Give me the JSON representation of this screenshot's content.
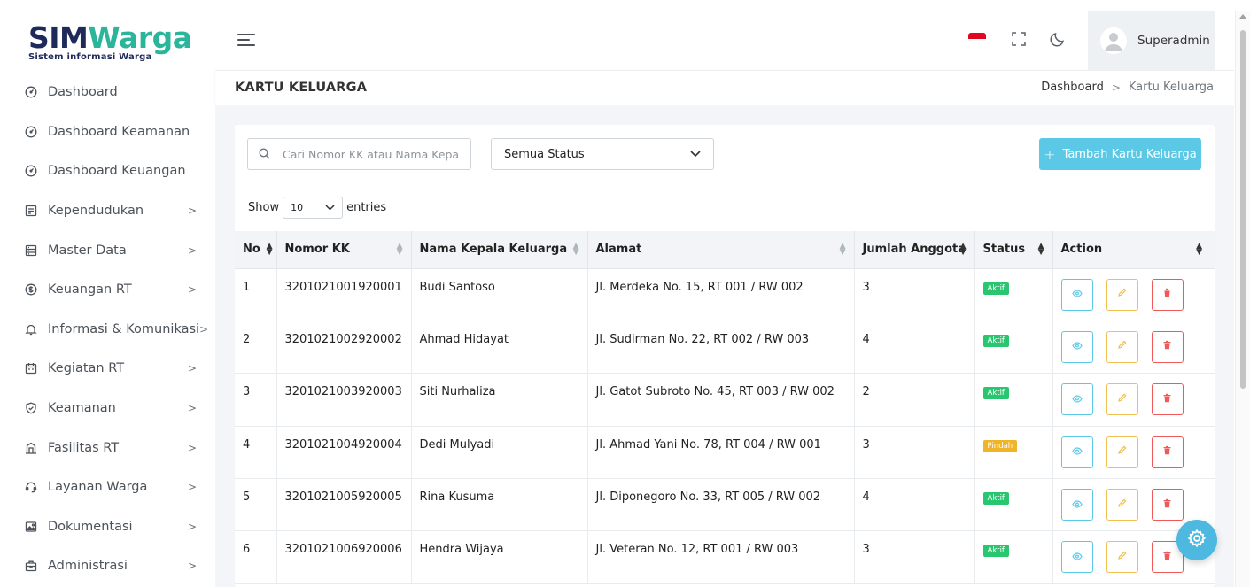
{
  "app": {
    "logo_sim": "SIM",
    "logo_warga": "Warga",
    "logo_sub": "Sistem informasi Warga"
  },
  "sidebar": {
    "items": [
      {
        "label": "Dashboard",
        "icon": "gauge-icon",
        "has_submenu": false
      },
      {
        "label": "Dashboard Keamanan",
        "icon": "gauge-icon",
        "has_submenu": false
      },
      {
        "label": "Dashboard Keuangan",
        "icon": "gauge-icon",
        "has_submenu": false
      },
      {
        "label": "Kependudukan",
        "icon": "id-card-icon",
        "has_submenu": true
      },
      {
        "label": "Master Data",
        "icon": "database-icon",
        "has_submenu": true
      },
      {
        "label": "Keuangan RT",
        "icon": "dollar-circle-icon",
        "has_submenu": true
      },
      {
        "label": "Informasi & Komunikasi",
        "icon": "bell-icon",
        "has_submenu": true
      },
      {
        "label": "Kegiatan RT",
        "icon": "calendar-icon",
        "has_submenu": true
      },
      {
        "label": "Keamanan",
        "icon": "shield-icon",
        "has_submenu": true
      },
      {
        "label": "Fasilitas RT",
        "icon": "building-icon",
        "has_submenu": true
      },
      {
        "label": "Layanan Warga",
        "icon": "support-icon",
        "has_submenu": true
      },
      {
        "label": "Dokumentasi",
        "icon": "image-icon",
        "has_submenu": true
      },
      {
        "label": "Administrasi",
        "icon": "briefcase-icon",
        "has_submenu": true
      }
    ],
    "chevron": ">"
  },
  "header": {
    "user_name": "Superadmin"
  },
  "titlebar": {
    "title": "KARTU KELUARGA",
    "breadcrumb_home": "Dashboard",
    "breadcrumb_sep": ">",
    "breadcrumb_current": "Kartu Keluarga"
  },
  "toolbar": {
    "search_placeholder": "Cari Nomor KK atau Nama Kepala Keluarga",
    "status_filter": "Semua Status",
    "add_label": "Tambah Kartu Keluarga",
    "add_plus": "+"
  },
  "length": {
    "show": "Show",
    "value": "10",
    "entries": "entries"
  },
  "table": {
    "headers": [
      "No",
      "Nomor KK",
      "Nama Kepala Keluarga",
      "Alamat",
      "Jumlah Anggota",
      "Status",
      "Action"
    ],
    "rows": [
      {
        "no": "1",
        "kk": "3201021001920001",
        "nama": "Budi Santoso",
        "alamat": "Jl. Merdeka No. 15, RT 001 / RW 002",
        "jumlah": "3",
        "status": "Aktif",
        "status_color": "#28c76f"
      },
      {
        "no": "2",
        "kk": "3201021002920002",
        "nama": "Ahmad Hidayat",
        "alamat": "Jl. Sudirman No. 22, RT 002 / RW 003",
        "jumlah": "4",
        "status": "Aktif",
        "status_color": "#28c76f"
      },
      {
        "no": "3",
        "kk": "3201021003920003",
        "nama": "Siti Nurhaliza",
        "alamat": "Jl. Gatot Subroto No. 45, RT 003 / RW 002",
        "jumlah": "2",
        "status": "Aktif",
        "status_color": "#28c76f"
      },
      {
        "no": "4",
        "kk": "3201021004920004",
        "nama": "Dedi Mulyadi",
        "alamat": "Jl. Ahmad Yani No. 78, RT 004 / RW 001",
        "jumlah": "3",
        "status": "Pindah",
        "status_color": "#f0b429"
      },
      {
        "no": "5",
        "kk": "3201021005920005",
        "nama": "Rina Kusuma",
        "alamat": "Jl. Diponegoro No. 33, RT 005 / RW 002",
        "jumlah": "4",
        "status": "Aktif",
        "status_color": "#28c76f"
      },
      {
        "no": "6",
        "kk": "3201021006920006",
        "nama": "Hendra Wijaya",
        "alamat": "Jl. Veteran No. 12, RT 001 / RW 003",
        "jumlah": "3",
        "status": "Aktif",
        "status_color": "#28c76f"
      }
    ]
  },
  "colors": {
    "accent": "#5bc8e6",
    "active": "#28c76f",
    "moved": "#f0b429",
    "danger": "#ee5a5a",
    "warning": "#f0c050"
  }
}
